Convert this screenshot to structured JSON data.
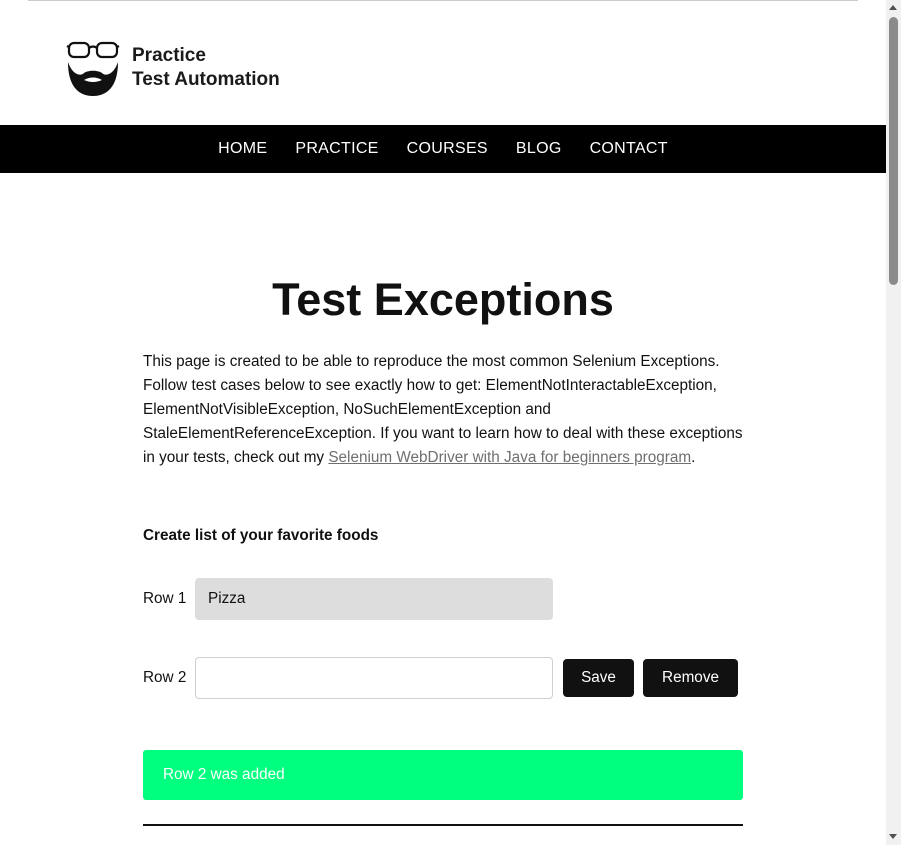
{
  "header": {
    "logo_line1": "Practice",
    "logo_line2": "Test Automation"
  },
  "nav": {
    "items": [
      "HOME",
      "PRACTICE",
      "COURSES",
      "BLOG",
      "CONTACT"
    ]
  },
  "page": {
    "title": "Test Exceptions",
    "intro_text": "This page is created to be able to reproduce the most common Selenium Exceptions. Follow test cases below to see exactly how to get: ElementNotInteractableException, ElementNotVisibleException, NoSuchElementException and StaleElementReferenceException. If you want to learn how to deal with these exceptions in your tests, check out my ",
    "intro_link": "Selenium WebDriver with Java for beginners program",
    "intro_end": ".",
    "subheading": "Create list of your favorite foods"
  },
  "rows": [
    {
      "label": "Row 1",
      "value": "Pizza"
    },
    {
      "label": "Row 2",
      "value": ""
    }
  ],
  "buttons": {
    "save": "Save",
    "remove": "Remove"
  },
  "confirmation": "Row 2 was added",
  "colors": {
    "nav_bg": "#000000",
    "button_bg": "#111111",
    "confirmation_bg": "#00ff7f"
  }
}
